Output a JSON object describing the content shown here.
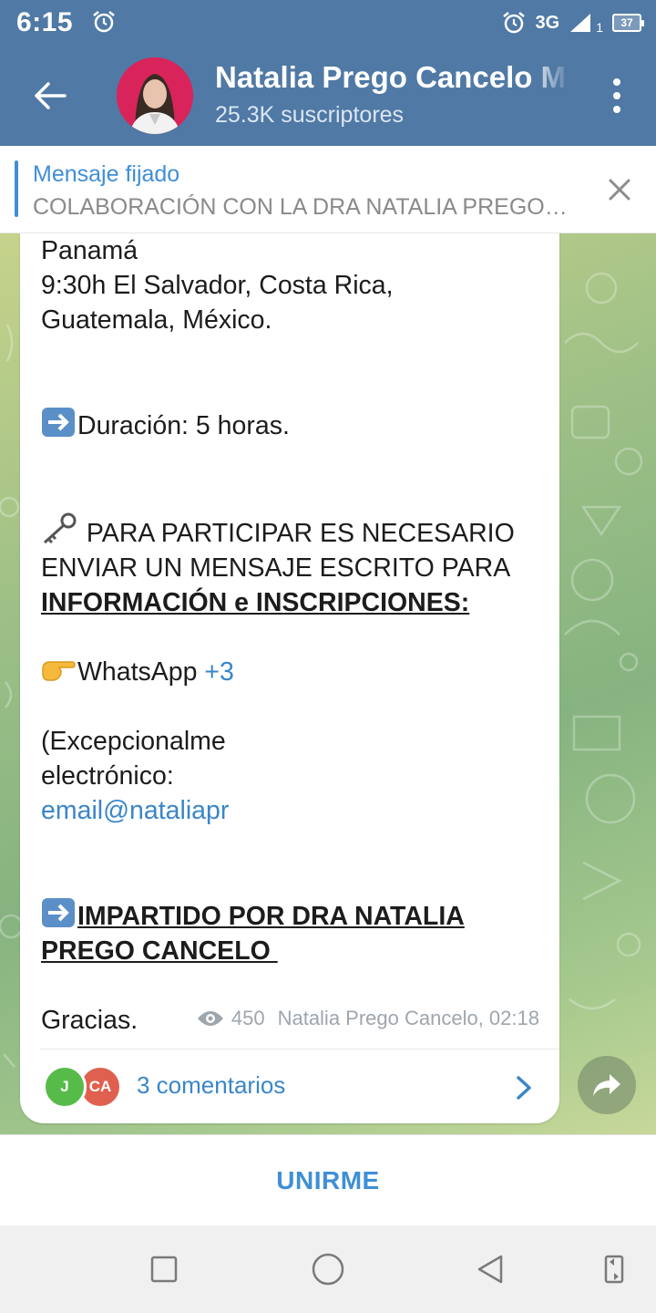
{
  "status_bar": {
    "time": "6:15",
    "network": "3G",
    "sim": "1",
    "battery": "37"
  },
  "header": {
    "title": "Natalia Prego Cancelo M",
    "subtitle": "25.3K suscriptores"
  },
  "pinned": {
    "title": "Mensaje fijado",
    "text": "COLABORACIÓN CON LA DRA NATALIA PREGO CANCELO"
  },
  "message": {
    "lines": {
      "panama": "Panamá",
      "time_line": "9:30h El Salvador, Costa Rica,",
      "countries": "Guatemala, México.",
      "duration": "Duración: 5 horas.",
      "participate_1": " PARA PARTICIPAR ES NECESARIO",
      "participate_2": "ENVIAR UN MENSAJE ESCRITO PARA",
      "info": "INFORMACIÓN e INSCRIPCIONES:",
      "whatsapp_label": "WhatsApp ",
      "whatsapp_link": "+3",
      "exceptional": "(Excepcionalme",
      "electronic": "electrónico:",
      "email": "email@nataliapr",
      "taught_1": "IMPARTIDO POR DRA NATALIA",
      "taught_2": "PREGO CANCELO ",
      "thanks": "Gracias."
    },
    "views": "450",
    "author_time": "Natalia Prego Cancelo, 02:18",
    "comments": {
      "avatar_1": "J",
      "avatar_2": "CA",
      "label": "3 comentarios"
    }
  },
  "join_button": "UNIRME",
  "colors": {
    "header": "#5079a5",
    "accent": "#3f8fd6",
    "link": "#3a86c9"
  },
  "icons": [
    "back-arrow-icon",
    "more-vert-icon",
    "alarm-icon",
    "close-icon",
    "eye-icon",
    "chevron-right-icon",
    "share-icon",
    "key-icon",
    "right-arrow-emoji-icon",
    "pointing-hand-emoji-icon",
    "square-icon",
    "circle-icon",
    "triangle-back-icon",
    "rotate-icon"
  ]
}
